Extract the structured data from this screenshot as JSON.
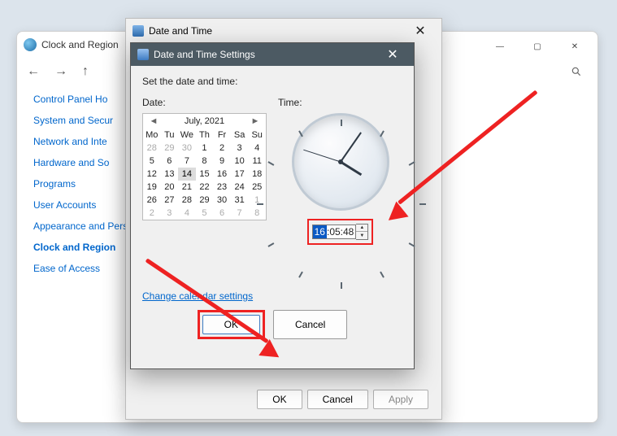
{
  "cp": {
    "title": "Clock and Region",
    "side": {
      "home": "Control Panel Ho",
      "items": [
        "System and Secur",
        "Network and Inte",
        "Hardware and So",
        "Programs",
        "User Accounts",
        "Appearance and Personalization",
        "Clock and Region",
        "Ease of Access"
      ]
    }
  },
  "dt": {
    "title": "Date and Time",
    "ok": "OK",
    "cancel": "Cancel",
    "apply": "Apply"
  },
  "dlg": {
    "title": "Date and Time Settings",
    "instruction": "Set the date and time:",
    "date_label": "Date:",
    "time_label": "Time:",
    "month": "July, 2021",
    "dow": [
      "Mo",
      "Tu",
      "We",
      "Th",
      "Fr",
      "Sa",
      "Su"
    ],
    "grid": [
      [
        {
          "d": 28,
          "dim": 1
        },
        {
          "d": 29,
          "dim": 1
        },
        {
          "d": 30,
          "dim": 1
        },
        {
          "d": 1
        },
        {
          "d": 2
        },
        {
          "d": 3
        },
        {
          "d": 4
        }
      ],
      [
        {
          "d": 5
        },
        {
          "d": 6
        },
        {
          "d": 7
        },
        {
          "d": 8
        },
        {
          "d": 9
        },
        {
          "d": 10
        },
        {
          "d": 11
        }
      ],
      [
        {
          "d": 12
        },
        {
          "d": 13
        },
        {
          "d": 14,
          "sel": 1
        },
        {
          "d": 15
        },
        {
          "d": 16
        },
        {
          "d": 17
        },
        {
          "d": 18
        }
      ],
      [
        {
          "d": 19
        },
        {
          "d": 20
        },
        {
          "d": 21
        },
        {
          "d": 22
        },
        {
          "d": 23
        },
        {
          "d": 24
        },
        {
          "d": 25
        }
      ],
      [
        {
          "d": 26
        },
        {
          "d": 27
        },
        {
          "d": 28
        },
        {
          "d": 29
        },
        {
          "d": 30
        },
        {
          "d": 31
        },
        {
          "d": 1,
          "dim": 1
        }
      ],
      [
        {
          "d": 2,
          "dim": 1
        },
        {
          "d": 3,
          "dim": 1
        },
        {
          "d": 4,
          "dim": 1
        },
        {
          "d": 5,
          "dim": 1
        },
        {
          "d": 6,
          "dim": 1
        },
        {
          "d": 7,
          "dim": 1
        },
        {
          "d": 8,
          "dim": 1
        }
      ]
    ],
    "time_hh": "16",
    "time_rest": ":05:48",
    "link": "Change calendar settings",
    "ok": "OK",
    "cancel": "Cancel"
  }
}
